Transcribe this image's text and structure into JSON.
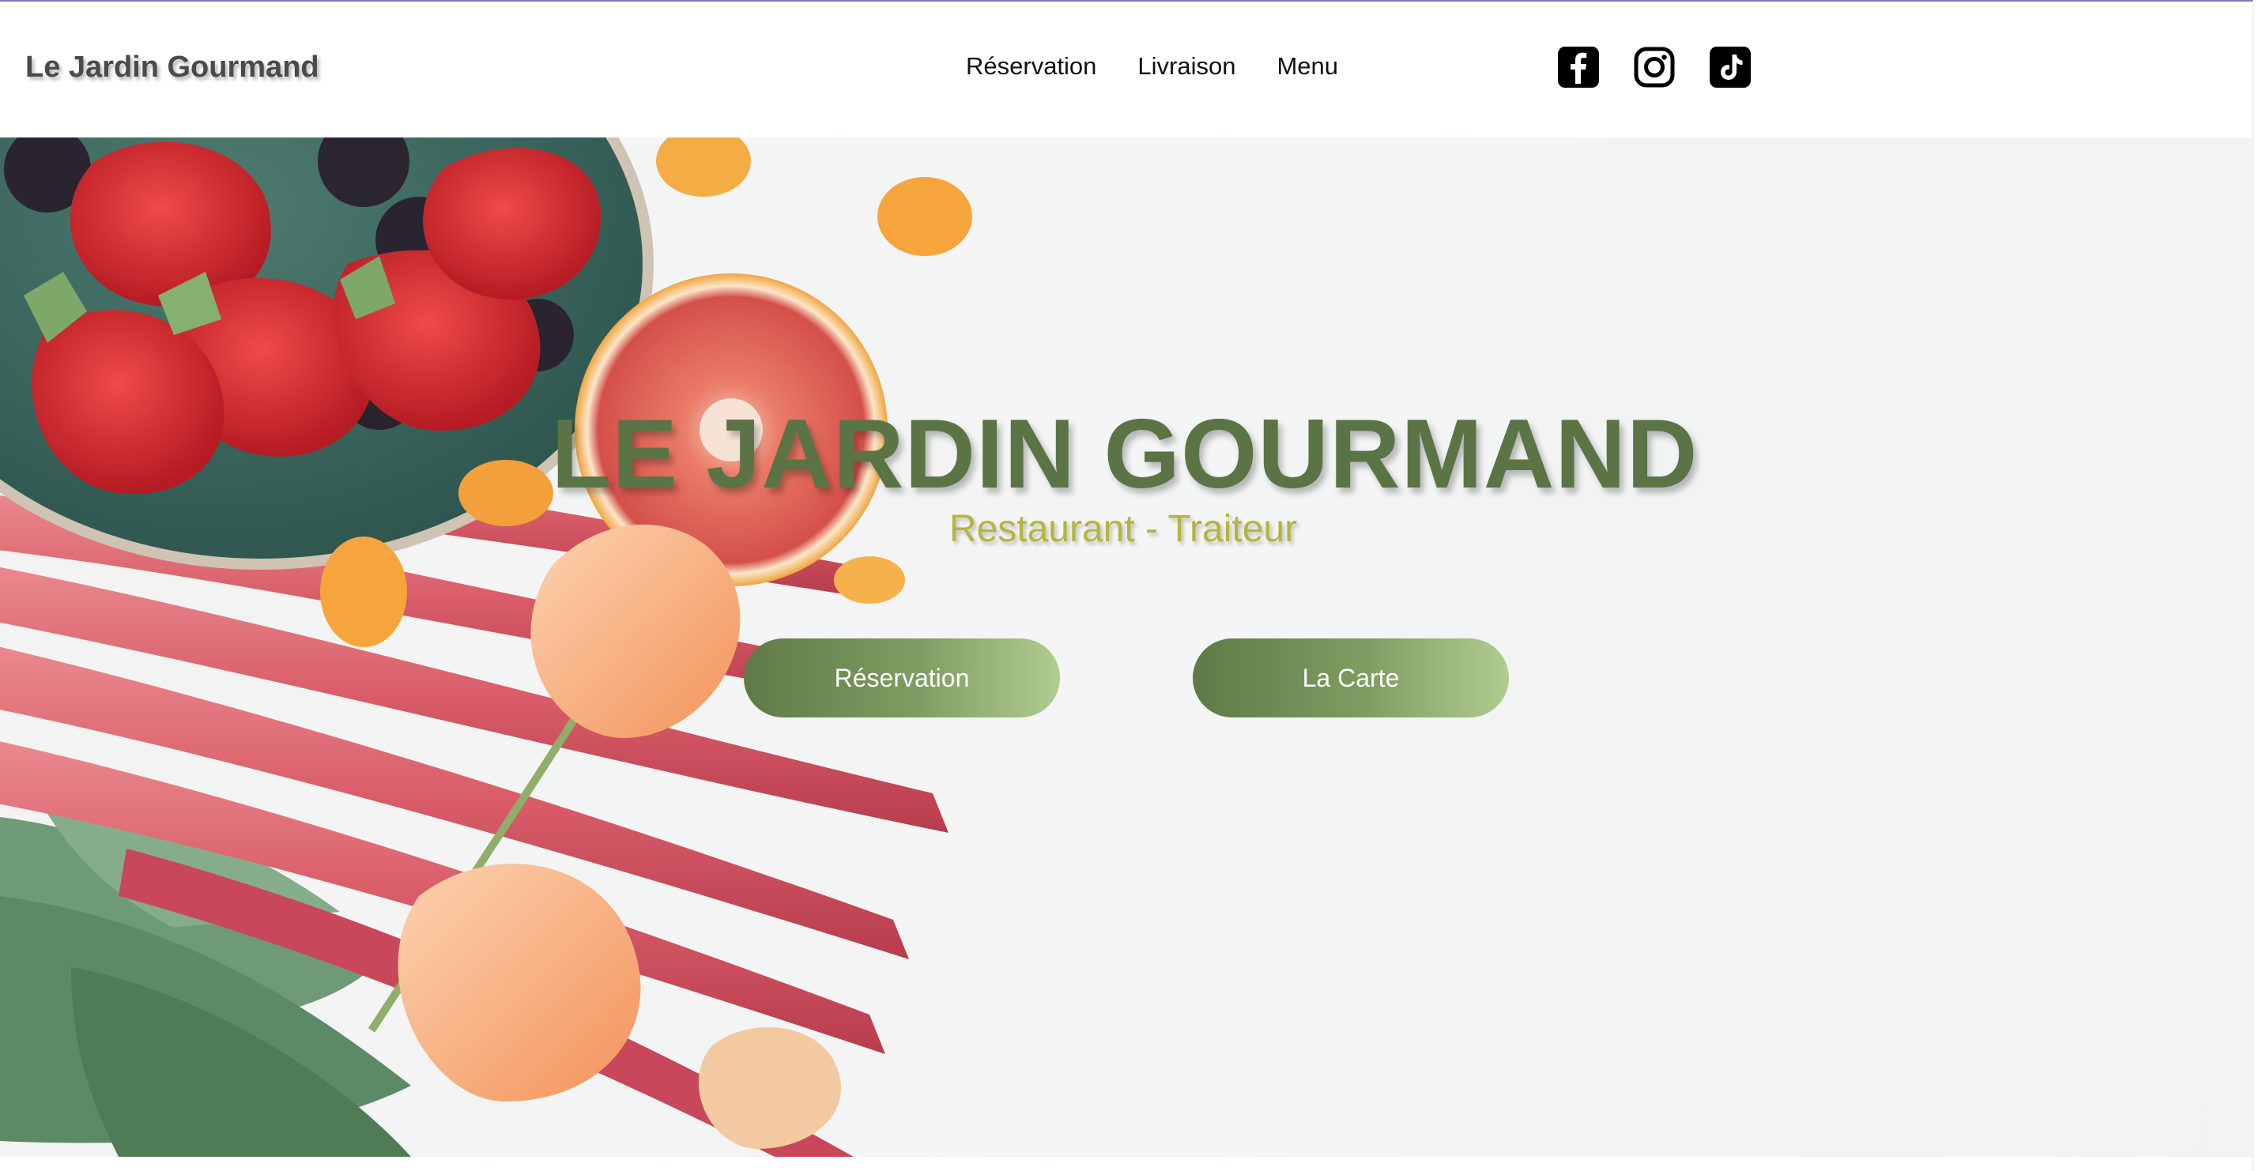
{
  "header": {
    "brand": "Le Jardin Gourmand",
    "nav": [
      {
        "label": "Réservation"
      },
      {
        "label": "Livraison"
      },
      {
        "label": "Menu"
      }
    ],
    "socials": [
      {
        "icon": "facebook-icon"
      },
      {
        "icon": "instagram-icon"
      },
      {
        "icon": "tiktok-icon"
      }
    ]
  },
  "hero": {
    "title": "LE JARDIN GOURMAND",
    "subtitle": "Restaurant - Traiteur",
    "buttons": {
      "reservation": "Réservation",
      "carte": "La Carte"
    }
  },
  "colors": {
    "accent_green": "#5b7445",
    "subtitle_olive": "#b5b53c",
    "button_gradient_start": "#5f7a47",
    "button_gradient_end": "#b0cc91",
    "top_rule": "#7d76b8"
  }
}
